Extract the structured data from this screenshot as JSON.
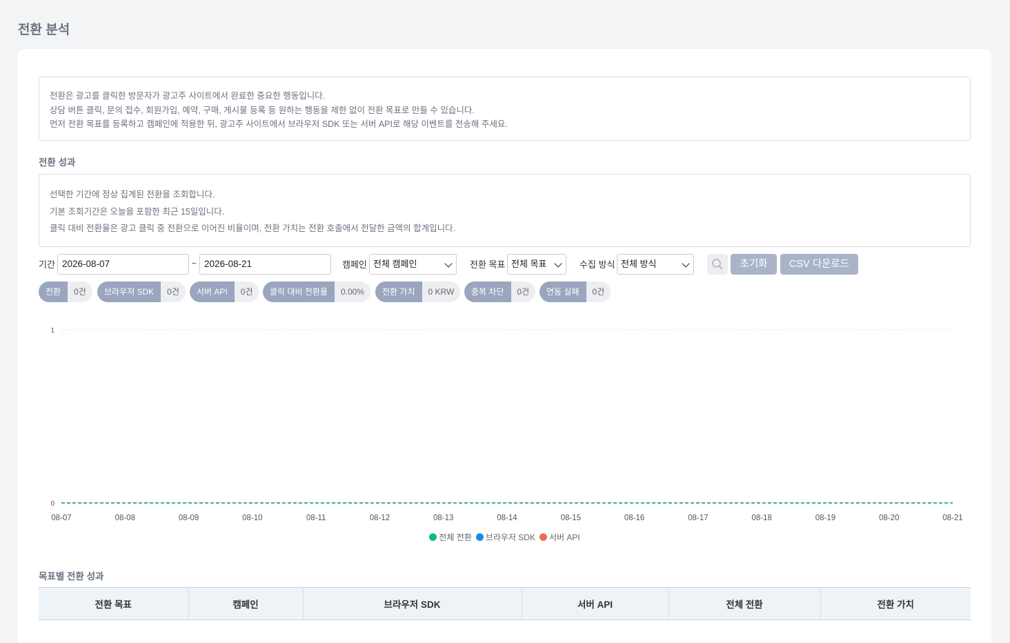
{
  "page": {
    "title": "전환 분석"
  },
  "intro": {
    "lines": [
      "전환은 광고를 클릭한 방문자가 광고주 사이트에서 완료한 중요한 행동입니다.",
      "상담 버튼 클릭, 문의 접수, 회원가입, 예약, 구매, 게시물 등록 등 원하는 행동을 제한 없이 전환 목표로 만들 수 있습니다.",
      "먼저 전환 목표를 등록하고 캠페인에 적용한 뒤, 광고주 사이트에서 브라우저 SDK 또는 서버 API로 해당 이벤트를 전송해 주세요."
    ]
  },
  "performance": {
    "title": "전환 성과",
    "notes": [
      "선택한 기간에 정상 집계된 전환을 조회합니다.",
      "기본 조회기간은 오늘을 포함한 최근 15일입니다.",
      "클릭 대비 전환율은 광고 클릭 중 전환으로 이어진 비율이며, 전환 가치는 전환 호출에서 전달한 금액의 합계입니다."
    ]
  },
  "filters": {
    "period_label": "기간",
    "start_date": "2026-08-07",
    "separator": "~",
    "end_date": "2026-08-21",
    "campaign_label": "캠페인",
    "campaign_value": "전체 캠페인",
    "goal_label": "전환 목표",
    "goal_value": "전체 목표",
    "method_label": "수집 방식",
    "method_value": "전체 방식",
    "search_icon": "search-icon",
    "reset_label": "초기화",
    "csv_label": "CSV 다운로드"
  },
  "stats": [
    {
      "label": "전환",
      "value": "0건"
    },
    {
      "label": "브라우저 SDK",
      "value": "0건"
    },
    {
      "label": "서버 API",
      "value": "0건"
    },
    {
      "label": "클릭 대비 전환율",
      "value": "0.00%"
    },
    {
      "label": "전환 가치",
      "value": "0 KRW"
    },
    {
      "label": "중복 차단",
      "value": "0건"
    },
    {
      "label": "연동 실패",
      "value": "0건"
    }
  ],
  "chart_data": {
    "type": "line",
    "x": [
      "08-07",
      "08-08",
      "08-09",
      "08-10",
      "08-11",
      "08-12",
      "08-13",
      "08-14",
      "08-15",
      "08-16",
      "08-17",
      "08-18",
      "08-19",
      "08-20",
      "08-21"
    ],
    "ylim": [
      0,
      1
    ],
    "yticks": [
      "0",
      "1"
    ],
    "grid": true,
    "legend_position": "bottom",
    "series": [
      {
        "name": "전체 전환",
        "color": "#10b981",
        "values": [
          0,
          0,
          0,
          0,
          0,
          0,
          0,
          0,
          0,
          0,
          0,
          0,
          0,
          0,
          0
        ]
      },
      {
        "name": "브라우저 SDK",
        "color": "#1e88e5",
        "values": [
          0,
          0,
          0,
          0,
          0,
          0,
          0,
          0,
          0,
          0,
          0,
          0,
          0,
          0,
          0
        ]
      },
      {
        "name": "서버 API",
        "color": "#e8704a",
        "values": [
          0,
          0,
          0,
          0,
          0,
          0,
          0,
          0,
          0,
          0,
          0,
          0,
          0,
          0,
          0
        ]
      }
    ]
  },
  "goal_table": {
    "title": "목표별 전환 성과",
    "headers": [
      "전환 목표",
      "캠페인",
      "브라우저 SDK",
      "서버 API",
      "전체 전환",
      "전환 가치"
    ]
  }
}
